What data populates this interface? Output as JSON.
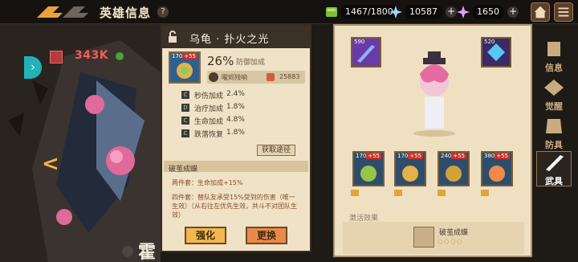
{
  "header": {
    "title": "英雄信息",
    "help": "?"
  },
  "resources": [
    {
      "icon": "stamina-icon",
      "value": "1467/1800"
    },
    {
      "icon": "crystal-icon",
      "value": "10587"
    },
    {
      "icon": "diamond-icon",
      "value": "1650"
    }
  ],
  "hero": {
    "power": "343K",
    "name_fragment": "霍",
    "side_arrow": "<",
    "side_tab_arrow": "›"
  },
  "card": {
    "title": "乌龟 · 扑火之光",
    "item_level": "170",
    "item_plus": "+55",
    "main_percent": "26%",
    "main_attr": "防御加成",
    "burn_label": "曜烬残响",
    "burn_value": "25883",
    "stats": [
      {
        "grade": "C",
        "name": "秒伤加成",
        "value": "2.4%"
      },
      {
        "grade": "D",
        "name": "治疗加成",
        "value": "1.8%"
      },
      {
        "grade": "C",
        "name": "生命加成",
        "value": "4.8%"
      },
      {
        "grade": "C",
        "name": "跌落恢复",
        "value": "1.8%"
      }
    ],
    "source_button": "获取途径",
    "set_name": "破茧成蝶",
    "set_two": "两件套：生命加成+15%",
    "set_four": "四件套：替队友承受15%受到的伤害（唯一生效）（从右往左优先生效，共斗不对团队生效）",
    "strengthen": "强化",
    "replace": "更换"
  },
  "equipment": {
    "top_slots": [
      {
        "level": "590"
      },
      {
        "level": "520"
      }
    ],
    "slots": [
      {
        "level": "170",
        "plus": "+55"
      },
      {
        "level": "170",
        "plus": "+55"
      },
      {
        "level": "240",
        "plus": "+55"
      },
      {
        "level": "380",
        "plus": "+55"
      }
    ],
    "activate_label": "激活效果",
    "activate_name": "破茧成蝶",
    "activate_diamonds": "◇◇◇◇"
  },
  "side_tabs": [
    {
      "label": "信息",
      "active": false
    },
    {
      "label": "觉醒",
      "active": false
    },
    {
      "label": "防具",
      "active": false
    },
    {
      "label": "武具",
      "active": true
    }
  ],
  "colors": {
    "accent_orange": "#f2b84e",
    "power_red": "#ff5a52",
    "teal_tab": "#21b3b8"
  }
}
